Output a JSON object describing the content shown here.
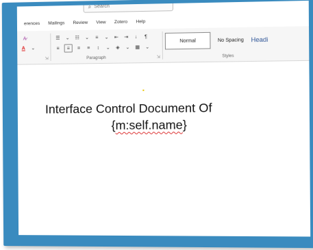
{
  "search": {
    "placeholder": "Search",
    "icon": "search-icon"
  },
  "tabs": [
    "erences",
    "Mailings",
    "Review",
    "View",
    "Zotero",
    "Help"
  ],
  "ribbon": {
    "paragraph_label": "Paragraph",
    "styles_label": "Styles",
    "styles": {
      "normal": "Normal",
      "no_spacing": "No Spacing",
      "heading": "Headi"
    },
    "icons": {
      "pilcrow": "¶",
      "sort": "↓",
      "font_color": "A"
    }
  },
  "document": {
    "title_line": "Interface Control Document Of",
    "field_open": "{",
    "field_text": "m:self.name",
    "field_close": "}"
  },
  "colors": {
    "frame": "#3a8bbf",
    "heading_style": "#2f5597",
    "spell_error": "#d33"
  }
}
